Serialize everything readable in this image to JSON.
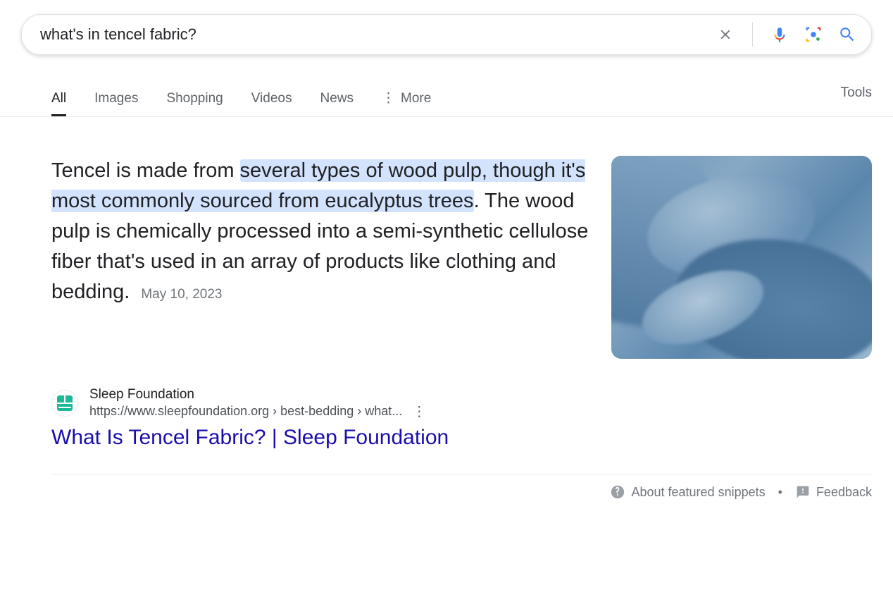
{
  "search": {
    "query": "what's in tencel fabric?"
  },
  "tabs": {
    "items": [
      {
        "label": "All",
        "active": true
      },
      {
        "label": "Images",
        "active": false
      },
      {
        "label": "Shopping",
        "active": false
      },
      {
        "label": "Videos",
        "active": false
      },
      {
        "label": "News",
        "active": false
      }
    ],
    "more_label": "More",
    "tools_label": "Tools"
  },
  "snippet": {
    "text_pre": "Tencel is made from ",
    "text_highlight": "several types of wood pulp, though it's most commonly sourced from eucalyptus trees",
    "text_post": ". The wood pulp is chemically processed into a semi-synthetic cellulose fiber that's used in an array of products like clothing and bedding.",
    "date": "May 10, 2023"
  },
  "source": {
    "site_name": "Sleep Foundation",
    "url_display": "https://www.sleepfoundation.org › best-bedding › what...",
    "title": "What Is Tencel Fabric? | Sleep Foundation"
  },
  "footer": {
    "about_label": "About featured snippets",
    "feedback_label": "Feedback"
  }
}
